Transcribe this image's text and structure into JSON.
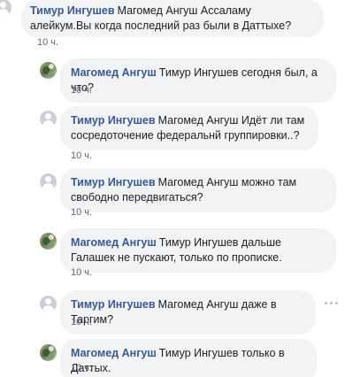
{
  "comments": [
    {
      "author": "Тимур Ингушев",
      "text": "Магомед Ангуш Ассаламу алейкум.Вы когда последний раз были в Даттыхе?",
      "time": "10 ч.",
      "avatar": "default-profile-icon"
    },
    {
      "author": "Магомед Ангуш",
      "text": "Тимур Ингушев сегодня был, а что?",
      "time": "10 ч.",
      "avatar": "user-photo"
    },
    {
      "author": "Тимур Ингушев",
      "text": "Магомед Ангуш Идёт ли там сосредоточение федеральнй группировки..?",
      "time": "10 ч.",
      "avatar": "default-profile-icon"
    },
    {
      "author": "Тимур Ингушев",
      "text": "Магомед Ангуш можно там свободно передвигаться?",
      "time": "10 ч.",
      "avatar": "default-profile-icon"
    },
    {
      "author": "Магомед Ангуш",
      "text": "Тимур Ингушев дальше Галашек не пускают, только по прописке.",
      "time": "10 ч.",
      "avatar": "user-photo"
    },
    {
      "author": "Тимур Ингушев",
      "text": "Магомед Ангуш даже в Таргим?",
      "time": "10 ч.",
      "avatar": "default-profile-icon",
      "has_options": true
    },
    {
      "author": "Магомед Ангуш",
      "text": "Тимур Ингушев только в Даттых.",
      "time": "10 ч.",
      "avatar": "user-photo"
    }
  ],
  "colors": {
    "author_link": "#385898",
    "bubble_bg": "#f2f3f5",
    "meta_text": "#606770"
  }
}
